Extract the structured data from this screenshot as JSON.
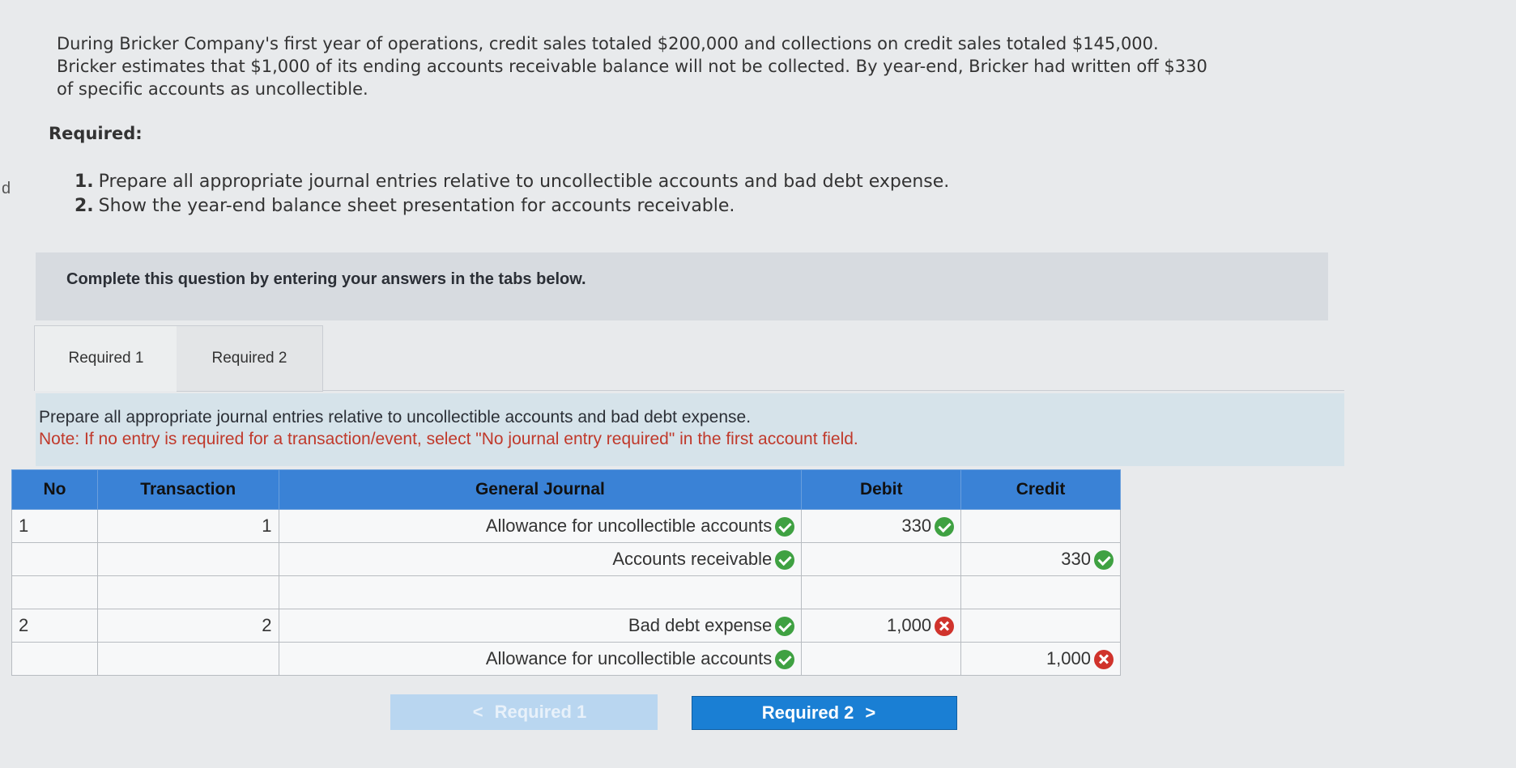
{
  "problem": {
    "side_mark": "d",
    "line1": "During Bricker Company's first year of operations, credit sales totaled $200,000 and collections on credit sales totaled $145,000.",
    "line2": "Bricker estimates that $1,000 of its ending accounts receivable balance will not be collected. By year-end, Bricker had written off $330",
    "line3": "of specific accounts as uncollectible.",
    "required_heading": "Required:",
    "req1_num": "1.",
    "req1": "Prepare all appropriate journal entries relative to uncollectible accounts and bad debt expense.",
    "req2_num": "2.",
    "req2": "Show the year-end balance sheet presentation for accounts receivable."
  },
  "instruction": "Complete this question by entering your answers in the tabs below.",
  "tabs": [
    {
      "label": "Required 1",
      "active": true
    },
    {
      "label": "Required 2",
      "active": false
    }
  ],
  "prompt": {
    "text": "Prepare all appropriate journal entries relative to uncollectible accounts and bad debt expense.",
    "note": "Note: If no entry is required for a transaction/event, select \"No journal entry required\" in the first account field."
  },
  "journal": {
    "headers": {
      "no": "No",
      "transaction": "Transaction",
      "account": "General Journal",
      "debit": "Debit",
      "credit": "Credit"
    },
    "rows": [
      {
        "no": "1",
        "transaction": "1",
        "account": "Allowance for uncollectible accounts",
        "account_status": "correct",
        "debit": "330",
        "debit_status": "correct",
        "credit": "",
        "credit_status": ""
      },
      {
        "no": "",
        "transaction": "",
        "account": "Accounts receivable",
        "account_status": "correct",
        "debit": "",
        "debit_status": "",
        "credit": "330",
        "credit_status": "correct"
      },
      {
        "no": "",
        "transaction": "",
        "account": "",
        "account_status": "",
        "debit": "",
        "debit_status": "",
        "credit": "",
        "credit_status": ""
      },
      {
        "no": "2",
        "transaction": "2",
        "account": "Bad debt expense",
        "account_status": "correct",
        "debit": "1,000",
        "debit_status": "incorrect",
        "credit": "",
        "credit_status": ""
      },
      {
        "no": "",
        "transaction": "",
        "account": "Allowance for uncollectible accounts",
        "account_status": "correct",
        "debit": "",
        "debit_status": "",
        "credit": "1,000",
        "credit_status": "incorrect"
      }
    ]
  },
  "nav": {
    "prev_label": "Required 1",
    "next_label": "Required 2",
    "prev_glyph": "<",
    "next_glyph": ">"
  },
  "colors": {
    "correct": "#3fa142",
    "incorrect": "#d0332c",
    "header_blue": "#3a82d6",
    "next_button": "#1a7fd4",
    "note_red": "#c0392b"
  }
}
